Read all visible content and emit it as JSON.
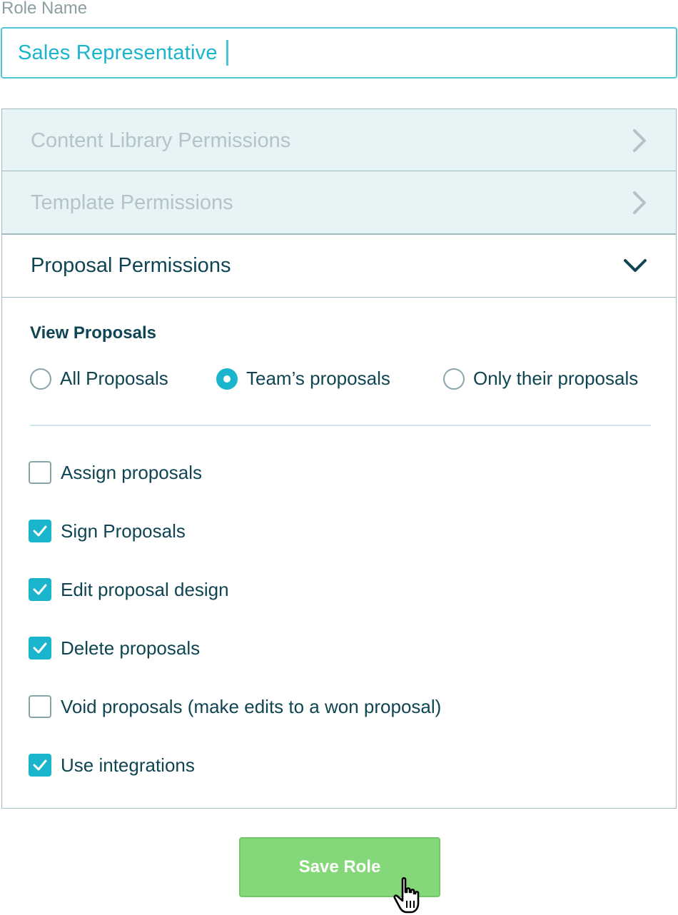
{
  "role_name": {
    "label": "Role Name",
    "value": "Sales Representative"
  },
  "accordion": {
    "content_library": {
      "title": "Content Library Permissions",
      "icon": "chevron-right-icon"
    },
    "template": {
      "title": "Template Permissions",
      "icon": "chevron-right-icon"
    },
    "proposal": {
      "title": "Proposal Permissions",
      "icon": "chevron-down-icon"
    }
  },
  "proposal_permissions": {
    "view_title": "View Proposals",
    "view_options": [
      {
        "label": "All Proposals",
        "selected": false
      },
      {
        "label": "Team’s proposals",
        "selected": true
      },
      {
        "label": "Only their proposals",
        "selected": false
      }
    ],
    "checkboxes": [
      {
        "label": "Assign proposals",
        "checked": false
      },
      {
        "label": "Sign Proposals",
        "checked": true
      },
      {
        "label": "Edit proposal design",
        "checked": true
      },
      {
        "label": "Delete proposals",
        "checked": true
      },
      {
        "label": "Void proposals (make edits to a won proposal)",
        "checked": false
      },
      {
        "label": "Use integrations",
        "checked": true
      }
    ]
  },
  "save_button": {
    "label": "Save Role"
  },
  "colors": {
    "accent": "#1ab5cc",
    "text": "#0f4553",
    "save": "#84d87a"
  }
}
